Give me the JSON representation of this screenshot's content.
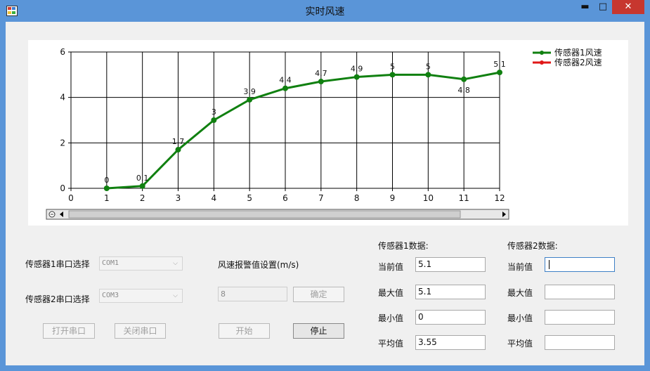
{
  "window": {
    "title": "实时风速",
    "min": "▬",
    "max": "□",
    "close": "✕"
  },
  "chart_data": {
    "type": "line",
    "x": [
      1,
      2,
      3,
      4,
      5,
      6,
      7,
      8,
      9,
      10,
      11,
      12
    ],
    "series": [
      {
        "name": "传感器1风速",
        "color": "#108010",
        "values": [
          0,
          0.1,
          1.7,
          3,
          3.9,
          4.4,
          4.7,
          4.9,
          5,
          5,
          4.8,
          5.1
        ],
        "labels": [
          "0",
          "0.1",
          "1.7",
          "3",
          "3.9",
          "4.4",
          "4.7",
          "4.9",
          "5",
          "5",
          "4.8",
          "5.1"
        ]
      },
      {
        "name": "传感器2风速",
        "color": "#e01818",
        "values": []
      }
    ],
    "xlim": [
      0,
      12
    ],
    "ylim": [
      0,
      6
    ],
    "xticks": [
      "0",
      "1",
      "2",
      "3",
      "4",
      "5",
      "6",
      "7",
      "8",
      "9",
      "10",
      "11",
      "12"
    ],
    "yticks": [
      "0",
      "2",
      "4",
      "6"
    ],
    "grid": true,
    "legend": "top-right"
  },
  "controls": {
    "port1_label": "传感器1串口选择",
    "port1_value": "COM1",
    "port2_label": "传感器2串口选择",
    "port2_value": "COM3",
    "open_port": "打开串口",
    "close_port": "关闭串口",
    "threshold_label": "风速报警值设置(m/s)",
    "threshold_value": "8",
    "confirm": "确定",
    "start": "开始",
    "stop": "停止"
  },
  "sensor1": {
    "title": "传感器1数据:",
    "current_label": "当前值",
    "current": "5.1",
    "max_label": "最大值",
    "max": "5.1",
    "min_label": "最小值",
    "min": "0",
    "avg_label": "平均值",
    "avg": "3.55"
  },
  "sensor2": {
    "title": "传感器2数据:",
    "current_label": "当前值",
    "current": "",
    "max_label": "最大值",
    "max": "",
    "min_label": "最小值",
    "min": "",
    "avg_label": "平均值",
    "avg": ""
  }
}
